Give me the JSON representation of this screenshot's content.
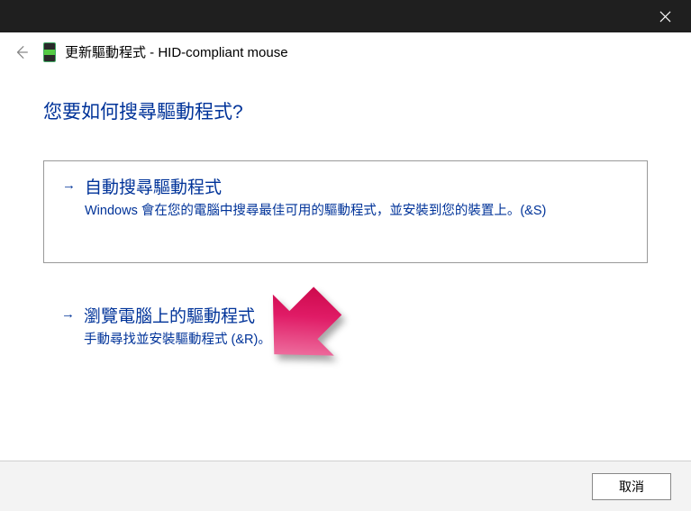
{
  "titlebar": {
    "close_tooltip": "Close"
  },
  "subheader": {
    "title": "更新驅動程式 - HID-compliant mouse"
  },
  "main": {
    "heading": "您要如何搜尋驅動程式?",
    "options": [
      {
        "arrow": "→",
        "title": "自動搜尋驅動程式",
        "desc": "Windows 會在您的電腦中搜尋最佳可用的驅動程式，並安裝到您的裝置上。(&S)"
      },
      {
        "arrow": "→",
        "title": "瀏覽電腦上的驅動程式",
        "desc": "手動尋找並安裝驅動程式 (&R)。"
      }
    ]
  },
  "footer": {
    "cancel_label": "取消"
  }
}
